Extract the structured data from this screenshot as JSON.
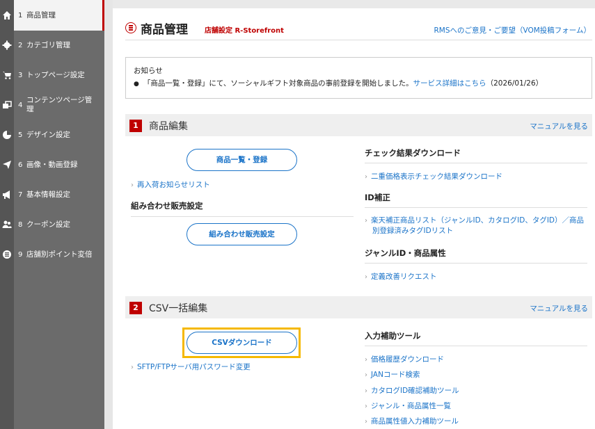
{
  "sidebar": {
    "items": [
      {
        "num": "1",
        "label": "商品管理",
        "icon": "home-icon",
        "active": true
      },
      {
        "num": "2",
        "label": "カテゴリ管理",
        "icon": "gear-icon"
      },
      {
        "num": "3",
        "label": "トップページ設定",
        "icon": "cart-icon"
      },
      {
        "num": "4",
        "label": "コンテンツページ管理",
        "icon": "pages-icon"
      },
      {
        "num": "5",
        "label": "デザイン設定",
        "icon": "palette-icon"
      },
      {
        "num": "6",
        "label": "画像・動画登録",
        "icon": "send-icon"
      },
      {
        "num": "7",
        "label": "基本情報設定",
        "icon": "megaphone-icon"
      },
      {
        "num": "8",
        "label": "クーポン設定",
        "icon": "users-icon"
      },
      {
        "num": "9",
        "label": "店舗別ポイント変倍",
        "icon": "list-icon"
      }
    ]
  },
  "header": {
    "title": "商品管理",
    "subtitle": "店舗設定 R-Storefront",
    "feedback_link": "RMSへのご意見・ご要望（VOM投稿フォーム）"
  },
  "notice": {
    "title": "お知らせ",
    "text": "「商品一覧・登録」にて、ソーシャルギフト対象商品の事前登録を開始しました。",
    "link": "サービス詳細はこちら",
    "date": "（2026/01/26）"
  },
  "section1": {
    "num": "1",
    "title": "商品編集",
    "manual": "マニュアルを見る",
    "product_list_button": "商品一覧・登録",
    "restock_link": "再入荷お知らせリスト",
    "combo_heading": "組み合わせ販売設定",
    "combo_button": "組み合わせ販売設定",
    "check_heading": "チェック結果ダウンロード",
    "double_price_link": "二重価格表示チェック結果ダウンロード",
    "id_heading": "ID補正",
    "id_link_line1": "楽天補正商品リスト（ジャンルID、カタログID、タグID）／商品",
    "id_link_line2": "別登録済みタグIDリスト",
    "genre_heading": "ジャンルID・商品属性",
    "definition_link": "定義改善リクエスト"
  },
  "section2": {
    "num": "2",
    "title": "CSV一括編集",
    "manual": "マニュアルを見る",
    "csv_button": "CSVダウンロード",
    "sftp_link": "SFTP/FTPサーバ用パスワード変更",
    "tools_heading": "入力補助ツール",
    "tools": [
      "価格履歴ダウンロード",
      "JANコード検索",
      "カタログID確認補助ツール",
      "ジャンル・商品属性一覧",
      "商品属性値入力補助ツール"
    ]
  },
  "colors": {
    "accent": "#bf0000",
    "link": "#1a73c8",
    "highlight": "#f5b800",
    "sidebar": "#6b6b6b"
  }
}
